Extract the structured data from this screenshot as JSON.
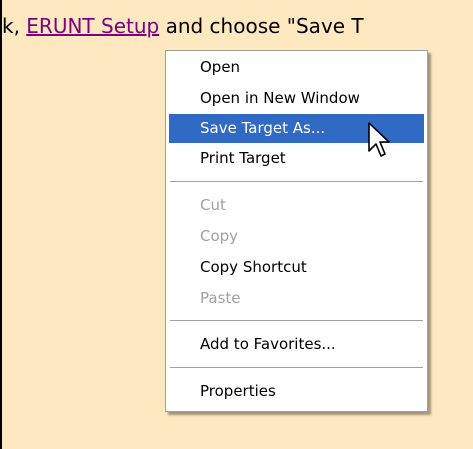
{
  "page": {
    "text_before": "k, ",
    "link_text": "ERUNT Setup",
    "text_after": "  and choose \"Save T",
    "link_color": "#800080",
    "background": "#fde8c0"
  },
  "context_menu": {
    "highlight_color": "#316ac5",
    "items": [
      {
        "label": "Open",
        "state": "normal"
      },
      {
        "label": "Open in New Window",
        "state": "normal"
      },
      {
        "label": "Save Target As...",
        "state": "highlighted"
      },
      {
        "label": "Print Target",
        "state": "normal"
      },
      {
        "label": "Cut",
        "state": "disabled"
      },
      {
        "label": "Copy",
        "state": "disabled"
      },
      {
        "label": "Copy Shortcut",
        "state": "normal"
      },
      {
        "label": "Paste",
        "state": "disabled"
      },
      {
        "label": "Add to Favorites...",
        "state": "normal"
      },
      {
        "label": "Properties",
        "state": "normal"
      }
    ]
  },
  "cursor": {
    "icon": "arrow-pointer-icon"
  }
}
